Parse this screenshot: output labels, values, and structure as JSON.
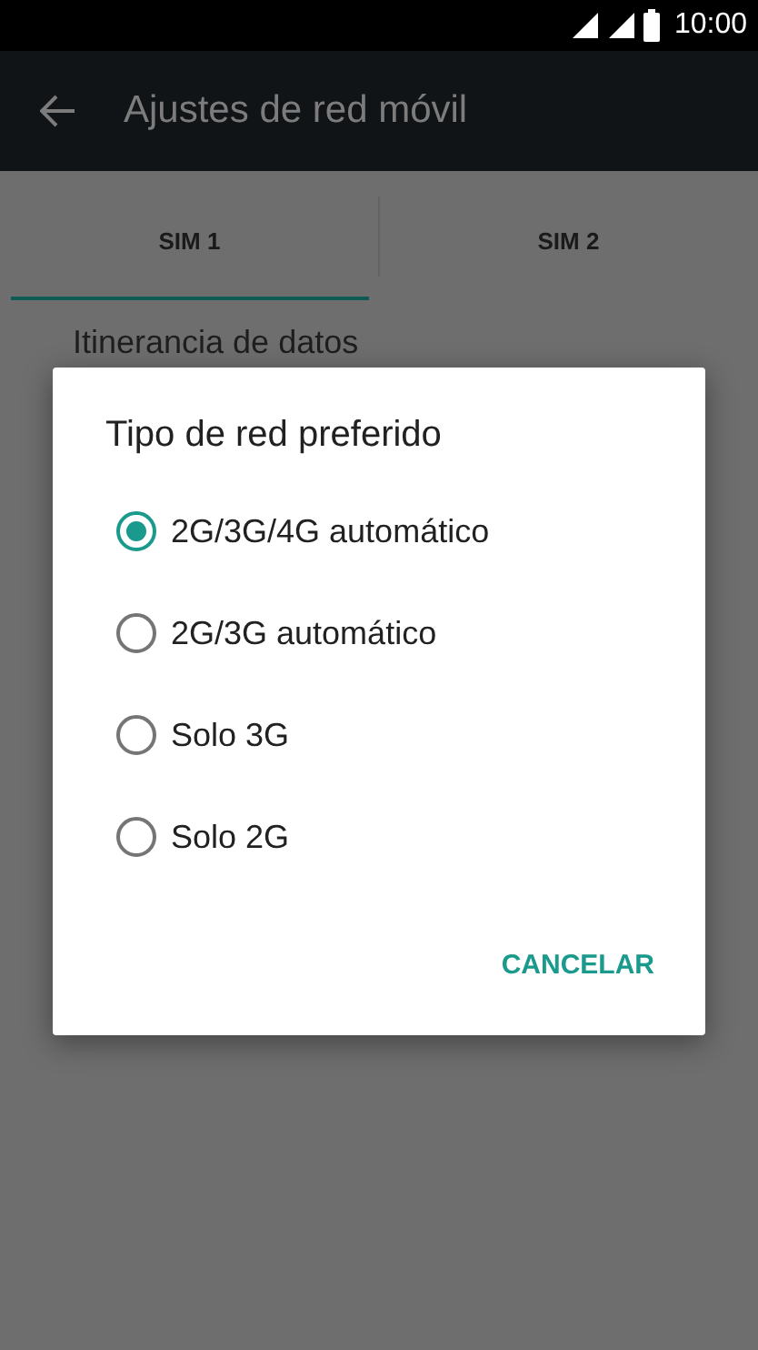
{
  "status_bar": {
    "time": "10:00"
  },
  "app_bar": {
    "title": "Ajustes de red móvil"
  },
  "tabs": [
    {
      "label": "SIM 1",
      "selected": true
    },
    {
      "label": "SIM 2",
      "selected": false
    }
  ],
  "settings": [
    {
      "label": "Itinerancia de datos"
    }
  ],
  "dialog": {
    "title": "Tipo de red preferido",
    "options": [
      {
        "label": "2G/3G/4G automático",
        "selected": true
      },
      {
        "label": "2G/3G automático",
        "selected": false
      },
      {
        "label": "Solo 3G",
        "selected": false
      },
      {
        "label": "Solo 2G",
        "selected": false
      }
    ],
    "buttons": [
      "CANCELAR"
    ]
  }
}
